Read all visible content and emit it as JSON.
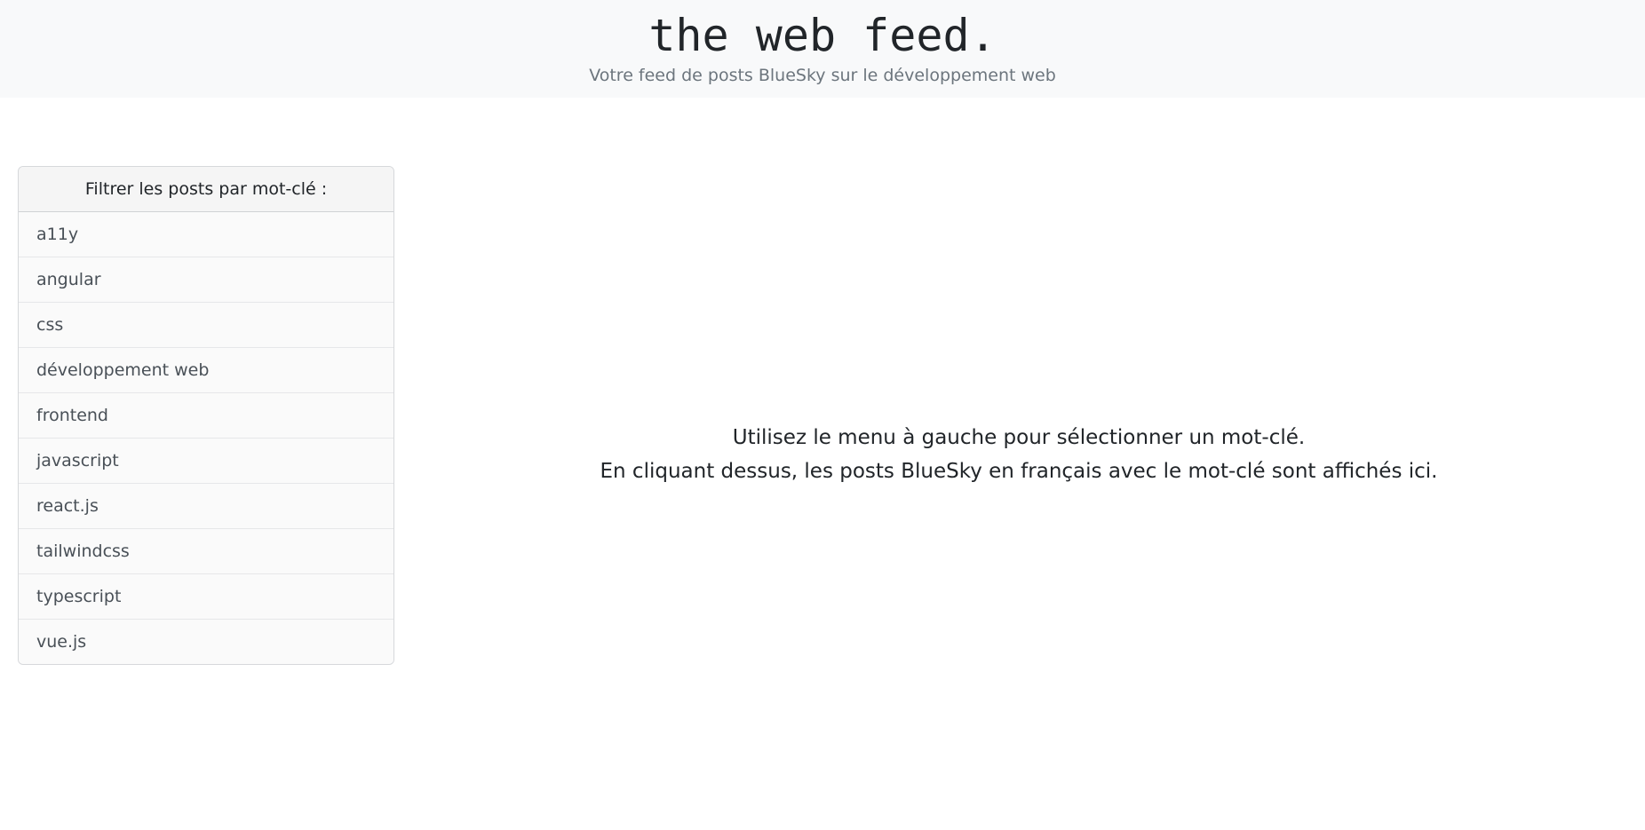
{
  "header": {
    "title": "the web feed.",
    "subtitle": "Votre feed de posts BlueSky sur le développement web"
  },
  "sidebar": {
    "heading": "Filtrer les posts par mot-clé :",
    "items": [
      {
        "label": "a11y"
      },
      {
        "label": "angular"
      },
      {
        "label": "css"
      },
      {
        "label": "développement web"
      },
      {
        "label": "frontend"
      },
      {
        "label": "javascript"
      },
      {
        "label": "react.js"
      },
      {
        "label": "tailwindcss"
      },
      {
        "label": "typescript"
      },
      {
        "label": "vue.js"
      }
    ]
  },
  "main": {
    "line1": "Utilisez le menu à gauche pour sélectionner un mot-clé.",
    "line2": "En cliquant dessus, les posts BlueSky en français avec le mot-clé sont affichés ici."
  },
  "colors": {
    "header_bg": "#f8f9fa",
    "text": "#212529",
    "muted": "#6c757d",
    "list_text": "#495057"
  }
}
